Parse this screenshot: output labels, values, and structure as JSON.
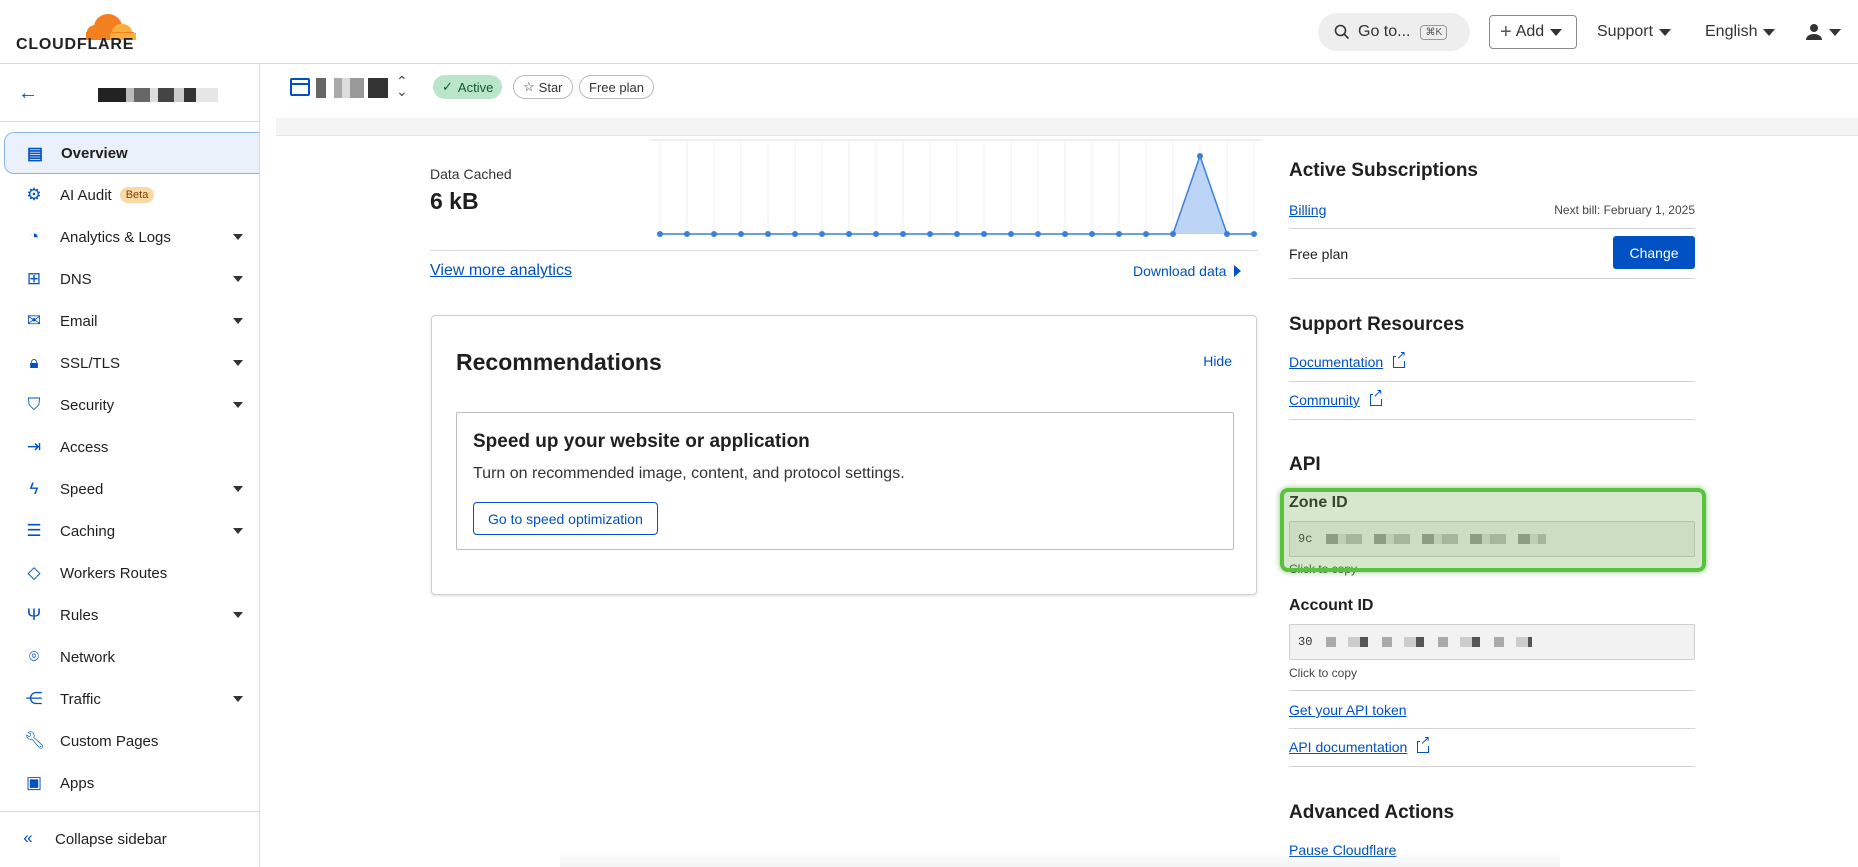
{
  "topbar": {
    "logo_text": "CLOUDFLARE",
    "goto_label": "Go to...",
    "goto_shortcut": "⌘K",
    "add_label": "Add",
    "support_label": "Support",
    "language_label": "English",
    "brand_color": "#f38020"
  },
  "sidebar": {
    "items": [
      {
        "label": "Overview",
        "icon": "document-icon"
      },
      {
        "label": "AI Audit",
        "icon": "robot-icon",
        "badge": "Beta"
      },
      {
        "label": "Analytics & Logs",
        "icon": "chart-pie-icon"
      },
      {
        "label": "DNS",
        "icon": "sitemap-icon"
      },
      {
        "label": "Email",
        "icon": "envelope-icon"
      },
      {
        "label": "SSL/TLS",
        "icon": "lock-icon"
      },
      {
        "label": "Security",
        "icon": "shield-icon"
      },
      {
        "label": "Access",
        "icon": "access-icon"
      },
      {
        "label": "Speed",
        "icon": "bolt-icon"
      },
      {
        "label": "Caching",
        "icon": "server-icon"
      },
      {
        "label": "Workers Routes",
        "icon": "workers-icon"
      },
      {
        "label": "Rules",
        "icon": "fork-icon"
      },
      {
        "label": "Network",
        "icon": "pin-icon"
      },
      {
        "label": "Traffic",
        "icon": "traffic-icon"
      },
      {
        "label": "Custom Pages",
        "icon": "wrench-icon"
      },
      {
        "label": "Apps",
        "icon": "apps-icon"
      }
    ],
    "collapse_label": "Collapse sidebar"
  },
  "zonebar": {
    "status": "Active",
    "star_label": "Star",
    "plan_label": "Free plan"
  },
  "analytics": {
    "data_cached_label": "Data Cached",
    "data_cached_value": "6 kB",
    "view_more": "View more analytics",
    "download": "Download data"
  },
  "chart_data": {
    "type": "area",
    "values": [
      0,
      0,
      0,
      0,
      0,
      0,
      0,
      0,
      0,
      0,
      0,
      0,
      0,
      0,
      0,
      0,
      0,
      0,
      0,
      0,
      1,
      0,
      0
    ],
    "ylim": [
      0,
      1
    ],
    "line_color": "#3a7fdc",
    "fill_color": "#bcd5f7"
  },
  "recommendations": {
    "title": "Recommendations",
    "hide_label": "Hide",
    "card_title": "Speed up your website or application",
    "card_desc": "Turn on recommended image, content, and protocol settings.",
    "card_button": "Go to speed optimization"
  },
  "subscriptions": {
    "title": "Active Subscriptions",
    "billing_link": "Billing",
    "next_bill": "Next bill: February 1, 2025",
    "plan": "Free plan",
    "change_label": "Change"
  },
  "support": {
    "title": "Support Resources",
    "documentation": "Documentation",
    "community": "Community"
  },
  "api": {
    "title": "API",
    "zone_id_label": "Zone ID",
    "zone_id_value": "9c",
    "account_id_label": "Account ID",
    "account_id_value": "30",
    "click_to_copy": "Click to copy",
    "token_link": "Get your API token",
    "docs_link": "API documentation"
  },
  "advanced": {
    "title": "Advanced Actions",
    "pause_link": "Pause Cloudflare"
  }
}
